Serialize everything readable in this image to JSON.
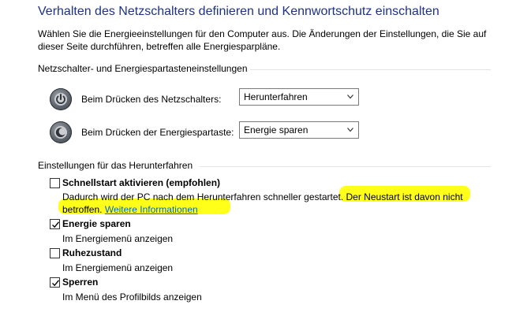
{
  "header": {
    "title": "Verhalten des Netzschalters definieren und Kennwortschutz einschalten",
    "description": "Wählen Sie die Energieeinstellungen für den Computer aus. Die Änderungen der Einstellungen, die Sie auf dieser Seite durchführen, betreffen alle Energiesparpläne."
  },
  "power_section": {
    "heading": "Netzschalter- und Energiespartasteneinstellungen",
    "rows": [
      {
        "label": "Beim Drücken des Netzschalters:",
        "selected": "Herunterfahren",
        "icon": "power-button-icon"
      },
      {
        "label": "Beim Drücken der Energiespartaste:",
        "selected": "Energie sparen",
        "icon": "sleep-button-icon"
      }
    ]
  },
  "shutdown_section": {
    "heading": "Einstellungen für das Herunterfahren",
    "options": [
      {
        "title": "Schnellstart aktivieren (empfohlen)",
        "checked": false,
        "desc_plain": "Dadurch wird der PC nach dem Herunterfahren schneller gestartet. ",
        "desc_highlight": "Der Neustart ist davon nicht",
        "desc_line2_highlight": "betroffen.",
        "link": "Weitere Informationen"
      },
      {
        "title": "Energie sparen",
        "checked": true,
        "desc": "Im Energiemenü anzeigen"
      },
      {
        "title": "Ruhezustand",
        "checked": false,
        "desc": "Im Energiemenü anzeigen"
      },
      {
        "title": "Sperren",
        "checked": true,
        "desc": "Im Menü des Profilbilds anzeigen"
      }
    ]
  },
  "colors": {
    "title": "#1e3287",
    "link": "#0066cc",
    "highlight": "#ffff00"
  }
}
